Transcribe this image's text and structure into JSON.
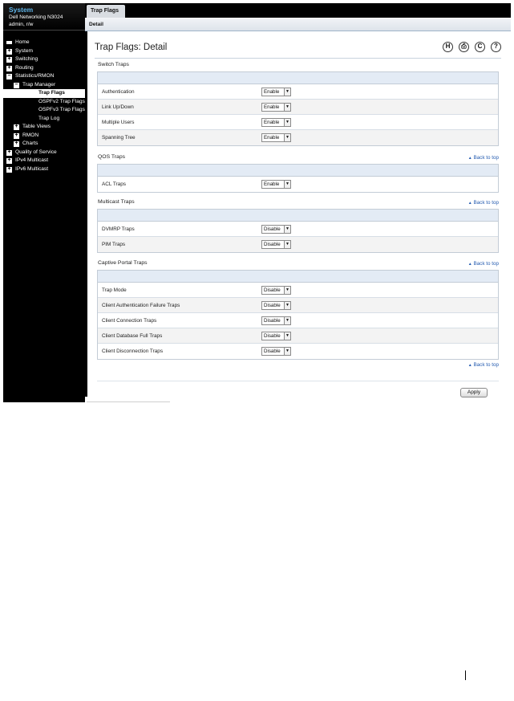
{
  "sidebar": {
    "title": "System",
    "device": "Dell Networking N3024",
    "user": "admin, r/w",
    "nav": [
      {
        "label": "Home",
        "depth": 0,
        "toggle": "dash"
      },
      {
        "label": "System",
        "depth": 0,
        "toggle": "plus"
      },
      {
        "label": "Switching",
        "depth": 0,
        "toggle": "plus"
      },
      {
        "label": "Routing",
        "depth": 0,
        "toggle": "plus"
      },
      {
        "label": "Statistics/RMON",
        "depth": 0,
        "toggle": "minus"
      },
      {
        "label": "Trap Manager",
        "depth": 1,
        "toggle": "minus"
      },
      {
        "label": "Trap Flags",
        "depth": 2,
        "toggle": "none",
        "selected": true
      },
      {
        "label": "OSPFv2 Trap Flags",
        "depth": 2,
        "toggle": "none"
      },
      {
        "label": "OSPFv3 Trap Flags",
        "depth": 2,
        "toggle": "none"
      },
      {
        "label": "Trap Log",
        "depth": 2,
        "toggle": "none"
      },
      {
        "label": "Table Views",
        "depth": 1,
        "toggle": "plus"
      },
      {
        "label": "RMON",
        "depth": 1,
        "toggle": "plus"
      },
      {
        "label": "Charts",
        "depth": 1,
        "toggle": "plus"
      },
      {
        "label": "Quality of Service",
        "depth": 0,
        "toggle": "plus"
      },
      {
        "label": "IPv4 Multicast",
        "depth": 0,
        "toggle": "plus"
      },
      {
        "label": "IPv6 Multicast",
        "depth": 0,
        "toggle": "plus"
      }
    ]
  },
  "header": {
    "tab": "Trap Flags",
    "subtab": "Detail"
  },
  "page": {
    "title": "Trap Flags: Detail",
    "tools": [
      "save-icon",
      "print-icon",
      "refresh-icon",
      "help-icon"
    ],
    "back_to_top": "Back to top",
    "apply": "Apply"
  },
  "sections": [
    {
      "title": "Switch Traps",
      "rows": [
        {
          "label": "Authentication",
          "value": "Enable"
        },
        {
          "label": "Link Up/Down",
          "value": "Enable"
        },
        {
          "label": "Multiple Users",
          "value": "Enable"
        },
        {
          "label": "Spanning Tree",
          "value": "Enable"
        }
      ]
    },
    {
      "title": "QOS Traps",
      "rows": [
        {
          "label": "ACL Traps",
          "value": "Enable"
        }
      ]
    },
    {
      "title": "Multicast Traps",
      "rows": [
        {
          "label": "DVMRP Traps",
          "value": "Disable"
        },
        {
          "label": "PIM Traps",
          "value": "Disable"
        }
      ]
    },
    {
      "title": "Captive Portal Traps",
      "rows": [
        {
          "label": "Trap Mode",
          "value": "Disable"
        },
        {
          "label": "Client Authentication Failure Traps",
          "value": "Disable"
        },
        {
          "label": "Client Connection Traps",
          "value": "Disable"
        },
        {
          "label": "Client Database Full Traps",
          "value": "Disable"
        },
        {
          "label": "Client Disconnection Traps",
          "value": "Disable"
        }
      ]
    }
  ]
}
